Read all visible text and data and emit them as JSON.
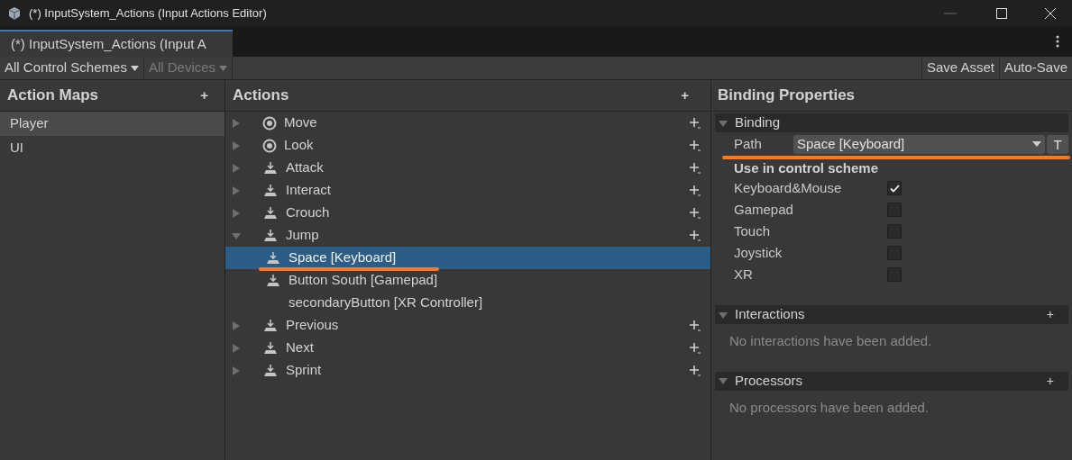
{
  "window": {
    "title": "(*) InputSystem_Actions (Input Actions Editor)"
  },
  "tabs": [
    {
      "label": "(*) InputSystem_Actions (Input A",
      "selected": true
    }
  ],
  "toolbar": {
    "left": [
      {
        "label": "All Control Schemes",
        "disabled": false
      },
      {
        "label": "All Devices",
        "disabled": true
      }
    ],
    "right": [
      "Save Asset",
      "Auto-Save"
    ]
  },
  "action_maps": {
    "title": "Action Maps",
    "add": "+",
    "items": [
      {
        "label": "Player",
        "selected": true
      },
      {
        "label": "UI",
        "selected": false
      }
    ]
  },
  "actions": {
    "title": "Actions",
    "add": "+",
    "items": [
      {
        "label": "Move",
        "kind": "value",
        "expanded": false,
        "selected": false
      },
      {
        "label": "Look",
        "kind": "value",
        "expanded": false,
        "selected": false
      },
      {
        "label": "Attack",
        "kind": "button",
        "expanded": false,
        "selected": false
      },
      {
        "label": "Interact",
        "kind": "button",
        "expanded": false,
        "selected": false
      },
      {
        "label": "Crouch",
        "kind": "button",
        "expanded": false,
        "selected": false
      },
      {
        "label": "Jump",
        "kind": "button",
        "expanded": true,
        "selected": false,
        "children": [
          {
            "label": "Space [Keyboard]",
            "kind": "button",
            "selected": true
          },
          {
            "label": "Button South [Gamepad]",
            "kind": "button",
            "selected": false
          },
          {
            "label": "secondaryButton [XR Controller]",
            "kind": "plain",
            "selected": false
          }
        ]
      },
      {
        "label": "Previous",
        "kind": "button",
        "expanded": false,
        "selected": false
      },
      {
        "label": "Next",
        "kind": "button",
        "expanded": false,
        "selected": false
      },
      {
        "label": "Sprint",
        "kind": "button",
        "expanded": false,
        "selected": false
      }
    ]
  },
  "binding_properties": {
    "title": "Binding Properties",
    "binding": {
      "title": "Binding",
      "expanded": true,
      "path_label": "Path",
      "path_value": "Space [Keyboard]",
      "t_button": "T",
      "scheme_title": "Use in control scheme",
      "schemes": [
        {
          "label": "Keyboard&Mouse",
          "checked": true
        },
        {
          "label": "Gamepad",
          "checked": false
        },
        {
          "label": "Touch",
          "checked": false
        },
        {
          "label": "Joystick",
          "checked": false
        },
        {
          "label": "XR",
          "checked": false
        }
      ]
    },
    "sections": [
      {
        "title": "Interactions",
        "expanded": true,
        "add": "+",
        "empty": "No interactions have been added."
      },
      {
        "title": "Processors",
        "expanded": true,
        "add": "+",
        "empty": "No processors have been added."
      }
    ]
  }
}
